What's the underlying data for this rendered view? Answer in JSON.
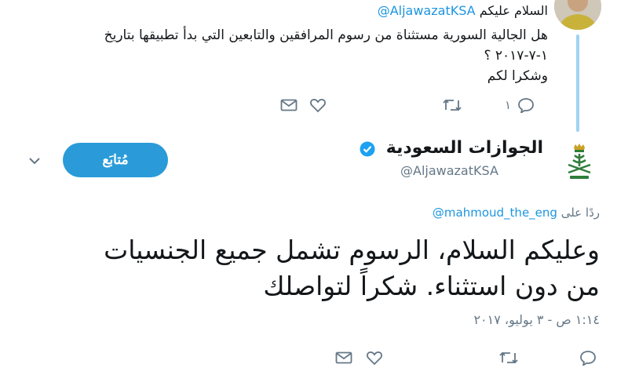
{
  "reply_tweet": {
    "greeting": "السلام عليكم",
    "handle": "@AljawazatKSA",
    "body_lines": [
      "هل الجالية السورية مستثناة من رسوم المرافقين والتابعين التي بدأ تطبيقها بتاريخ",
      "١-٧-٢٠١٧ ؟",
      "وشكرا لكم"
    ],
    "reply_count": "١",
    "avatar_icon": "profile-photo"
  },
  "main_tweet": {
    "display_name": "الجوازات السعودية",
    "screen_name": "@AljawazatKSA",
    "follow_label": "مُتابَع",
    "replying_prefix": "ردًا على",
    "replying_handle": "@mahmoud_the_eng",
    "text_lines": [
      "وعليكم السلام، الرسوم تشمل جميع الجنسيات",
      "من دون استثناء. شكراً لتواصلك"
    ],
    "timestamp": "١:١٤ ص - ٣ يوليو، ٢٠١٧",
    "avatar_icon": "saudi-emblem",
    "verified_icon": "verified-badge"
  },
  "colors": {
    "accent": "#1b95e0",
    "follow_button": "#2a9bd8",
    "thread_line": "#9fd3f5",
    "muted": "#657786"
  }
}
